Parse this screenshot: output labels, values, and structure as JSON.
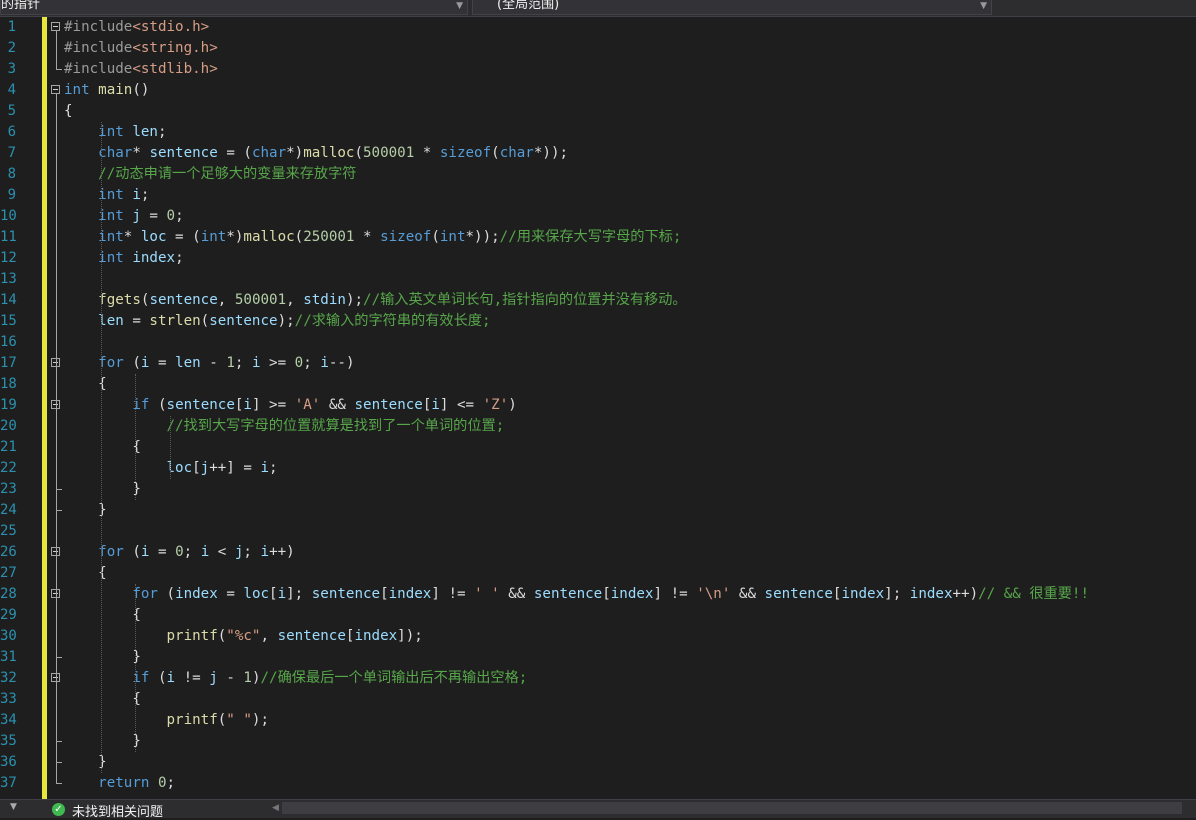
{
  "navbar": {
    "left_scope": "的指针",
    "right_scope": "(全局范围)"
  },
  "status": {
    "issues_text": "未找到相关问题"
  },
  "lines": [
    {
      "n": "1",
      "tokens": [
        [
          "pp",
          "#include"
        ],
        [
          "inc",
          "<stdio.h>"
        ]
      ]
    },
    {
      "n": "2",
      "tokens": [
        [
          "pp",
          "#include"
        ],
        [
          "inc",
          "<string.h>"
        ]
      ]
    },
    {
      "n": "3",
      "tokens": [
        [
          "pp",
          "#include"
        ],
        [
          "inc",
          "<stdlib.h>"
        ]
      ]
    },
    {
      "n": "4",
      "tokens": [
        [
          "k",
          "int"
        ],
        [
          "t",
          " "
        ],
        [
          "f",
          "main"
        ],
        [
          "t",
          "()"
        ]
      ]
    },
    {
      "n": "5",
      "tokens": [
        [
          "t",
          "{"
        ]
      ]
    },
    {
      "n": "6",
      "tokens": [
        [
          "t",
          "    "
        ],
        [
          "k",
          "int"
        ],
        [
          "t",
          " "
        ],
        [
          "v",
          "len"
        ],
        [
          "t",
          ";"
        ]
      ]
    },
    {
      "n": "7",
      "tokens": [
        [
          "t",
          "    "
        ],
        [
          "k",
          "char"
        ],
        [
          "t",
          "* "
        ],
        [
          "v",
          "sentence"
        ],
        [
          "t",
          " = ("
        ],
        [
          "k",
          "char"
        ],
        [
          "t",
          "*)"
        ],
        [
          "f",
          "malloc"
        ],
        [
          "t",
          "("
        ],
        [
          "n",
          "500001"
        ],
        [
          "t",
          " * "
        ],
        [
          "k",
          "sizeof"
        ],
        [
          "t",
          "("
        ],
        [
          "k",
          "char"
        ],
        [
          "t",
          "*));"
        ]
      ]
    },
    {
      "n": "8",
      "tokens": [
        [
          "t",
          "    "
        ],
        [
          "c",
          "//动态申请一个足够大的变量来存放字符"
        ]
      ]
    },
    {
      "n": "9",
      "tokens": [
        [
          "t",
          "    "
        ],
        [
          "k",
          "int"
        ],
        [
          "t",
          " "
        ],
        [
          "v",
          "i"
        ],
        [
          "t",
          ";"
        ]
      ]
    },
    {
      "n": "10",
      "tokens": [
        [
          "t",
          "    "
        ],
        [
          "k",
          "int"
        ],
        [
          "t",
          " "
        ],
        [
          "v",
          "j"
        ],
        [
          "t",
          " = "
        ],
        [
          "n",
          "0"
        ],
        [
          "t",
          ";"
        ]
      ]
    },
    {
      "n": "11",
      "tokens": [
        [
          "t",
          "    "
        ],
        [
          "k",
          "int"
        ],
        [
          "t",
          "* "
        ],
        [
          "v",
          "loc"
        ],
        [
          "t",
          " = ("
        ],
        [
          "k",
          "int"
        ],
        [
          "t",
          "*)"
        ],
        [
          "f",
          "malloc"
        ],
        [
          "t",
          "("
        ],
        [
          "n",
          "250001"
        ],
        [
          "t",
          " * "
        ],
        [
          "k",
          "sizeof"
        ],
        [
          "t",
          "("
        ],
        [
          "k",
          "int"
        ],
        [
          "t",
          "*));"
        ],
        [
          "c",
          "//用来保存大写字母的下标;"
        ]
      ]
    },
    {
      "n": "12",
      "tokens": [
        [
          "t",
          "    "
        ],
        [
          "k",
          "int"
        ],
        [
          "t",
          " "
        ],
        [
          "v",
          "index"
        ],
        [
          "t",
          ";"
        ]
      ]
    },
    {
      "n": "13",
      "tokens": []
    },
    {
      "n": "14",
      "tokens": [
        [
          "t",
          "    "
        ],
        [
          "f",
          "fgets"
        ],
        [
          "t",
          "("
        ],
        [
          "v",
          "sentence"
        ],
        [
          "t",
          ", "
        ],
        [
          "n",
          "500001"
        ],
        [
          "t",
          ", "
        ],
        [
          "v",
          "stdin"
        ],
        [
          "t",
          ");"
        ],
        [
          "c",
          "//输入英文单词长句,指针指向的位置并没有移动。"
        ]
      ]
    },
    {
      "n": "15",
      "tokens": [
        [
          "t",
          "    "
        ],
        [
          "v",
          "len"
        ],
        [
          "t",
          " = "
        ],
        [
          "f",
          "strlen"
        ],
        [
          "t",
          "("
        ],
        [
          "v",
          "sentence"
        ],
        [
          "t",
          ");"
        ],
        [
          "c",
          "//求输入的字符串的有效长度;"
        ]
      ]
    },
    {
      "n": "16",
      "tokens": []
    },
    {
      "n": "17",
      "tokens": [
        [
          "t",
          "    "
        ],
        [
          "k",
          "for"
        ],
        [
          "t",
          " ("
        ],
        [
          "v",
          "i"
        ],
        [
          "t",
          " = "
        ],
        [
          "v",
          "len"
        ],
        [
          "t",
          " - "
        ],
        [
          "n",
          "1"
        ],
        [
          "t",
          "; "
        ],
        [
          "v",
          "i"
        ],
        [
          "t",
          " >= "
        ],
        [
          "n",
          "0"
        ],
        [
          "t",
          "; "
        ],
        [
          "v",
          "i"
        ],
        [
          "t",
          "--)"
        ]
      ]
    },
    {
      "n": "18",
      "tokens": [
        [
          "t",
          "    {"
        ]
      ]
    },
    {
      "n": "19",
      "tokens": [
        [
          "t",
          "        "
        ],
        [
          "k",
          "if"
        ],
        [
          "t",
          " ("
        ],
        [
          "v",
          "sentence"
        ],
        [
          "t",
          "["
        ],
        [
          "v",
          "i"
        ],
        [
          "t",
          "] >= "
        ],
        [
          "s",
          "'A'"
        ],
        [
          "t",
          " && "
        ],
        [
          "v",
          "sentence"
        ],
        [
          "t",
          "["
        ],
        [
          "v",
          "i"
        ],
        [
          "t",
          "] <= "
        ],
        [
          "s",
          "'Z'"
        ],
        [
          "t",
          ")"
        ]
      ]
    },
    {
      "n": "20",
      "tokens": [
        [
          "t",
          "            "
        ],
        [
          "c",
          "//找到大写字母的位置就算是找到了一个单词的位置;"
        ]
      ]
    },
    {
      "n": "21",
      "tokens": [
        [
          "t",
          "        {"
        ]
      ]
    },
    {
      "n": "22",
      "tokens": [
        [
          "t",
          "            "
        ],
        [
          "v",
          "loc"
        ],
        [
          "t",
          "["
        ],
        [
          "v",
          "j"
        ],
        [
          "t",
          "++] = "
        ],
        [
          "v",
          "i"
        ],
        [
          "t",
          ";"
        ]
      ]
    },
    {
      "n": "23",
      "tokens": [
        [
          "t",
          "        }"
        ]
      ]
    },
    {
      "n": "24",
      "tokens": [
        [
          "t",
          "    }"
        ]
      ]
    },
    {
      "n": "25",
      "tokens": []
    },
    {
      "n": "26",
      "tokens": [
        [
          "t",
          "    "
        ],
        [
          "k",
          "for"
        ],
        [
          "t",
          " ("
        ],
        [
          "v",
          "i"
        ],
        [
          "t",
          " = "
        ],
        [
          "n",
          "0"
        ],
        [
          "t",
          "; "
        ],
        [
          "v",
          "i"
        ],
        [
          "t",
          " < "
        ],
        [
          "v",
          "j"
        ],
        [
          "t",
          "; "
        ],
        [
          "v",
          "i"
        ],
        [
          "t",
          "++)"
        ]
      ]
    },
    {
      "n": "27",
      "tokens": [
        [
          "t",
          "    {"
        ]
      ]
    },
    {
      "n": "28",
      "tokens": [
        [
          "t",
          "        "
        ],
        [
          "k",
          "for"
        ],
        [
          "t",
          " ("
        ],
        [
          "v",
          "index"
        ],
        [
          "t",
          " = "
        ],
        [
          "v",
          "loc"
        ],
        [
          "t",
          "["
        ],
        [
          "v",
          "i"
        ],
        [
          "t",
          "]; "
        ],
        [
          "v",
          "sentence"
        ],
        [
          "t",
          "["
        ],
        [
          "v",
          "index"
        ],
        [
          "t",
          "] != "
        ],
        [
          "s",
          "' '"
        ],
        [
          "t",
          " && "
        ],
        [
          "v",
          "sentence"
        ],
        [
          "t",
          "["
        ],
        [
          "v",
          "index"
        ],
        [
          "t",
          "] != "
        ],
        [
          "s",
          "'\\n'"
        ],
        [
          "t",
          " && "
        ],
        [
          "v",
          "sentence"
        ],
        [
          "t",
          "["
        ],
        [
          "v",
          "index"
        ],
        [
          "t",
          "]; "
        ],
        [
          "v",
          "index"
        ],
        [
          "t",
          "++)"
        ],
        [
          "c",
          "// && 很重要!!"
        ]
      ]
    },
    {
      "n": "29",
      "tokens": [
        [
          "t",
          "        {"
        ]
      ]
    },
    {
      "n": "30",
      "tokens": [
        [
          "t",
          "            "
        ],
        [
          "f",
          "printf"
        ],
        [
          "t",
          "("
        ],
        [
          "s",
          "\"%c\""
        ],
        [
          "t",
          ", "
        ],
        [
          "v",
          "sentence"
        ],
        [
          "t",
          "["
        ],
        [
          "v",
          "index"
        ],
        [
          "t",
          "]);"
        ]
      ]
    },
    {
      "n": "31",
      "tokens": [
        [
          "t",
          "        }"
        ]
      ]
    },
    {
      "n": "32",
      "tokens": [
        [
          "t",
          "        "
        ],
        [
          "k",
          "if"
        ],
        [
          "t",
          " ("
        ],
        [
          "v",
          "i"
        ],
        [
          "t",
          " != "
        ],
        [
          "v",
          "j"
        ],
        [
          "t",
          " - "
        ],
        [
          "n",
          "1"
        ],
        [
          "t",
          ")"
        ],
        [
          "c",
          "//确保最后一个单词输出后不再输出空格;"
        ]
      ]
    },
    {
      "n": "33",
      "tokens": [
        [
          "t",
          "        {"
        ]
      ]
    },
    {
      "n": "34",
      "tokens": [
        [
          "t",
          "            "
        ],
        [
          "f",
          "printf"
        ],
        [
          "t",
          "("
        ],
        [
          "s",
          "\" \""
        ],
        [
          "t",
          ");"
        ]
      ]
    },
    {
      "n": "35",
      "tokens": [
        [
          "t",
          "        }"
        ]
      ]
    },
    {
      "n": "36",
      "tokens": [
        [
          "t",
          "    }"
        ]
      ]
    },
    {
      "n": "37",
      "tokens": [
        [
          "t",
          "    "
        ],
        [
          "k",
          "return"
        ],
        [
          "t",
          " "
        ],
        [
          "n",
          "0"
        ],
        [
          "t",
          ";"
        ]
      ]
    }
  ]
}
